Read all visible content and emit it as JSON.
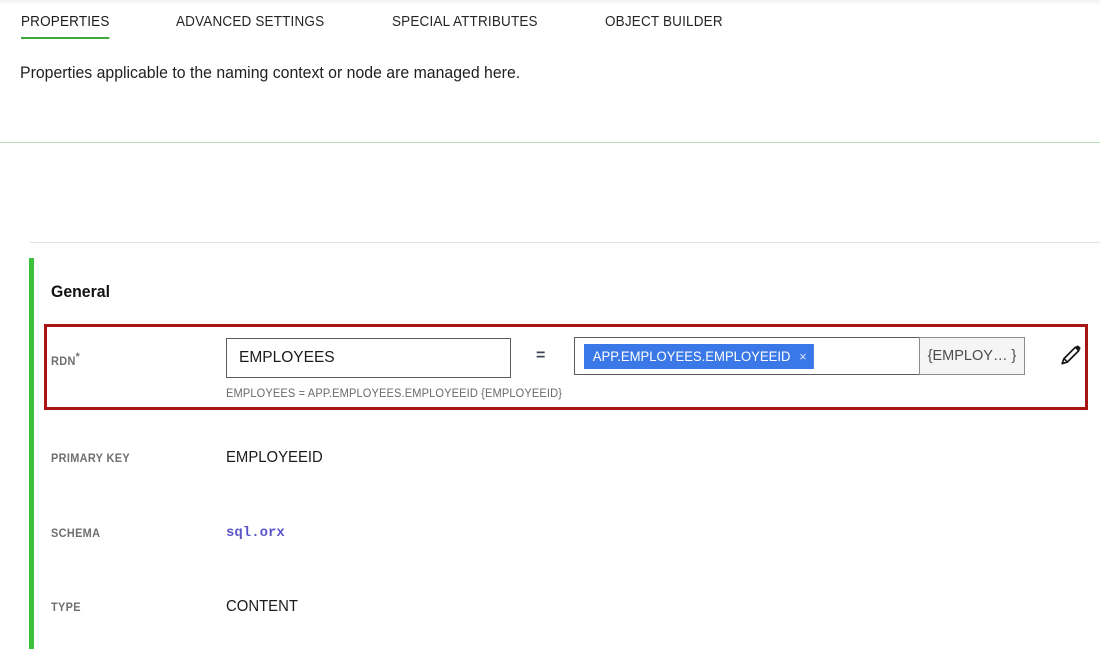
{
  "tabs": [
    {
      "label": "PROPERTIES",
      "active": true
    },
    {
      "label": "ADVANCED SETTINGS",
      "active": false
    },
    {
      "label": "SPECIAL ATTRIBUTES",
      "active": false
    },
    {
      "label": "OBJECT BUILDER",
      "active": false
    }
  ],
  "description": "Properties applicable to the naming context or node are managed here.",
  "section": {
    "title": "General"
  },
  "rdn": {
    "label": "RDN",
    "required_marker": "*",
    "input_value": "EMPLOYEES",
    "input_placeholder": "",
    "operator": "=",
    "chip_label": "APP.EMPLOYEES.EMPLOYEEID",
    "chip_remove_icon": "×",
    "suffix_value": "{EMPLOY… }",
    "helper_text": "EMPLOYEES = APP.EMPLOYEES.EMPLOYEEID {EMPLOYEEID}",
    "edit_icon": "pencil-icon"
  },
  "properties": [
    {
      "label": "PRIMARY KEY",
      "value": "EMPLOYEEID"
    },
    {
      "label": "SCHEMA",
      "value": "sql.orx"
    },
    {
      "label": "TYPE",
      "value": "CONTENT"
    }
  ],
  "colors": {
    "accent_green": "#3cc13c",
    "tab_underline_green": "#3fa93f",
    "separator_green": "#b9dfb9",
    "highlight_red": "#a81515",
    "chip_blue": "#3b78e7",
    "schema_purple": "#5a55c8",
    "label_gray": "#6f6f6f"
  }
}
